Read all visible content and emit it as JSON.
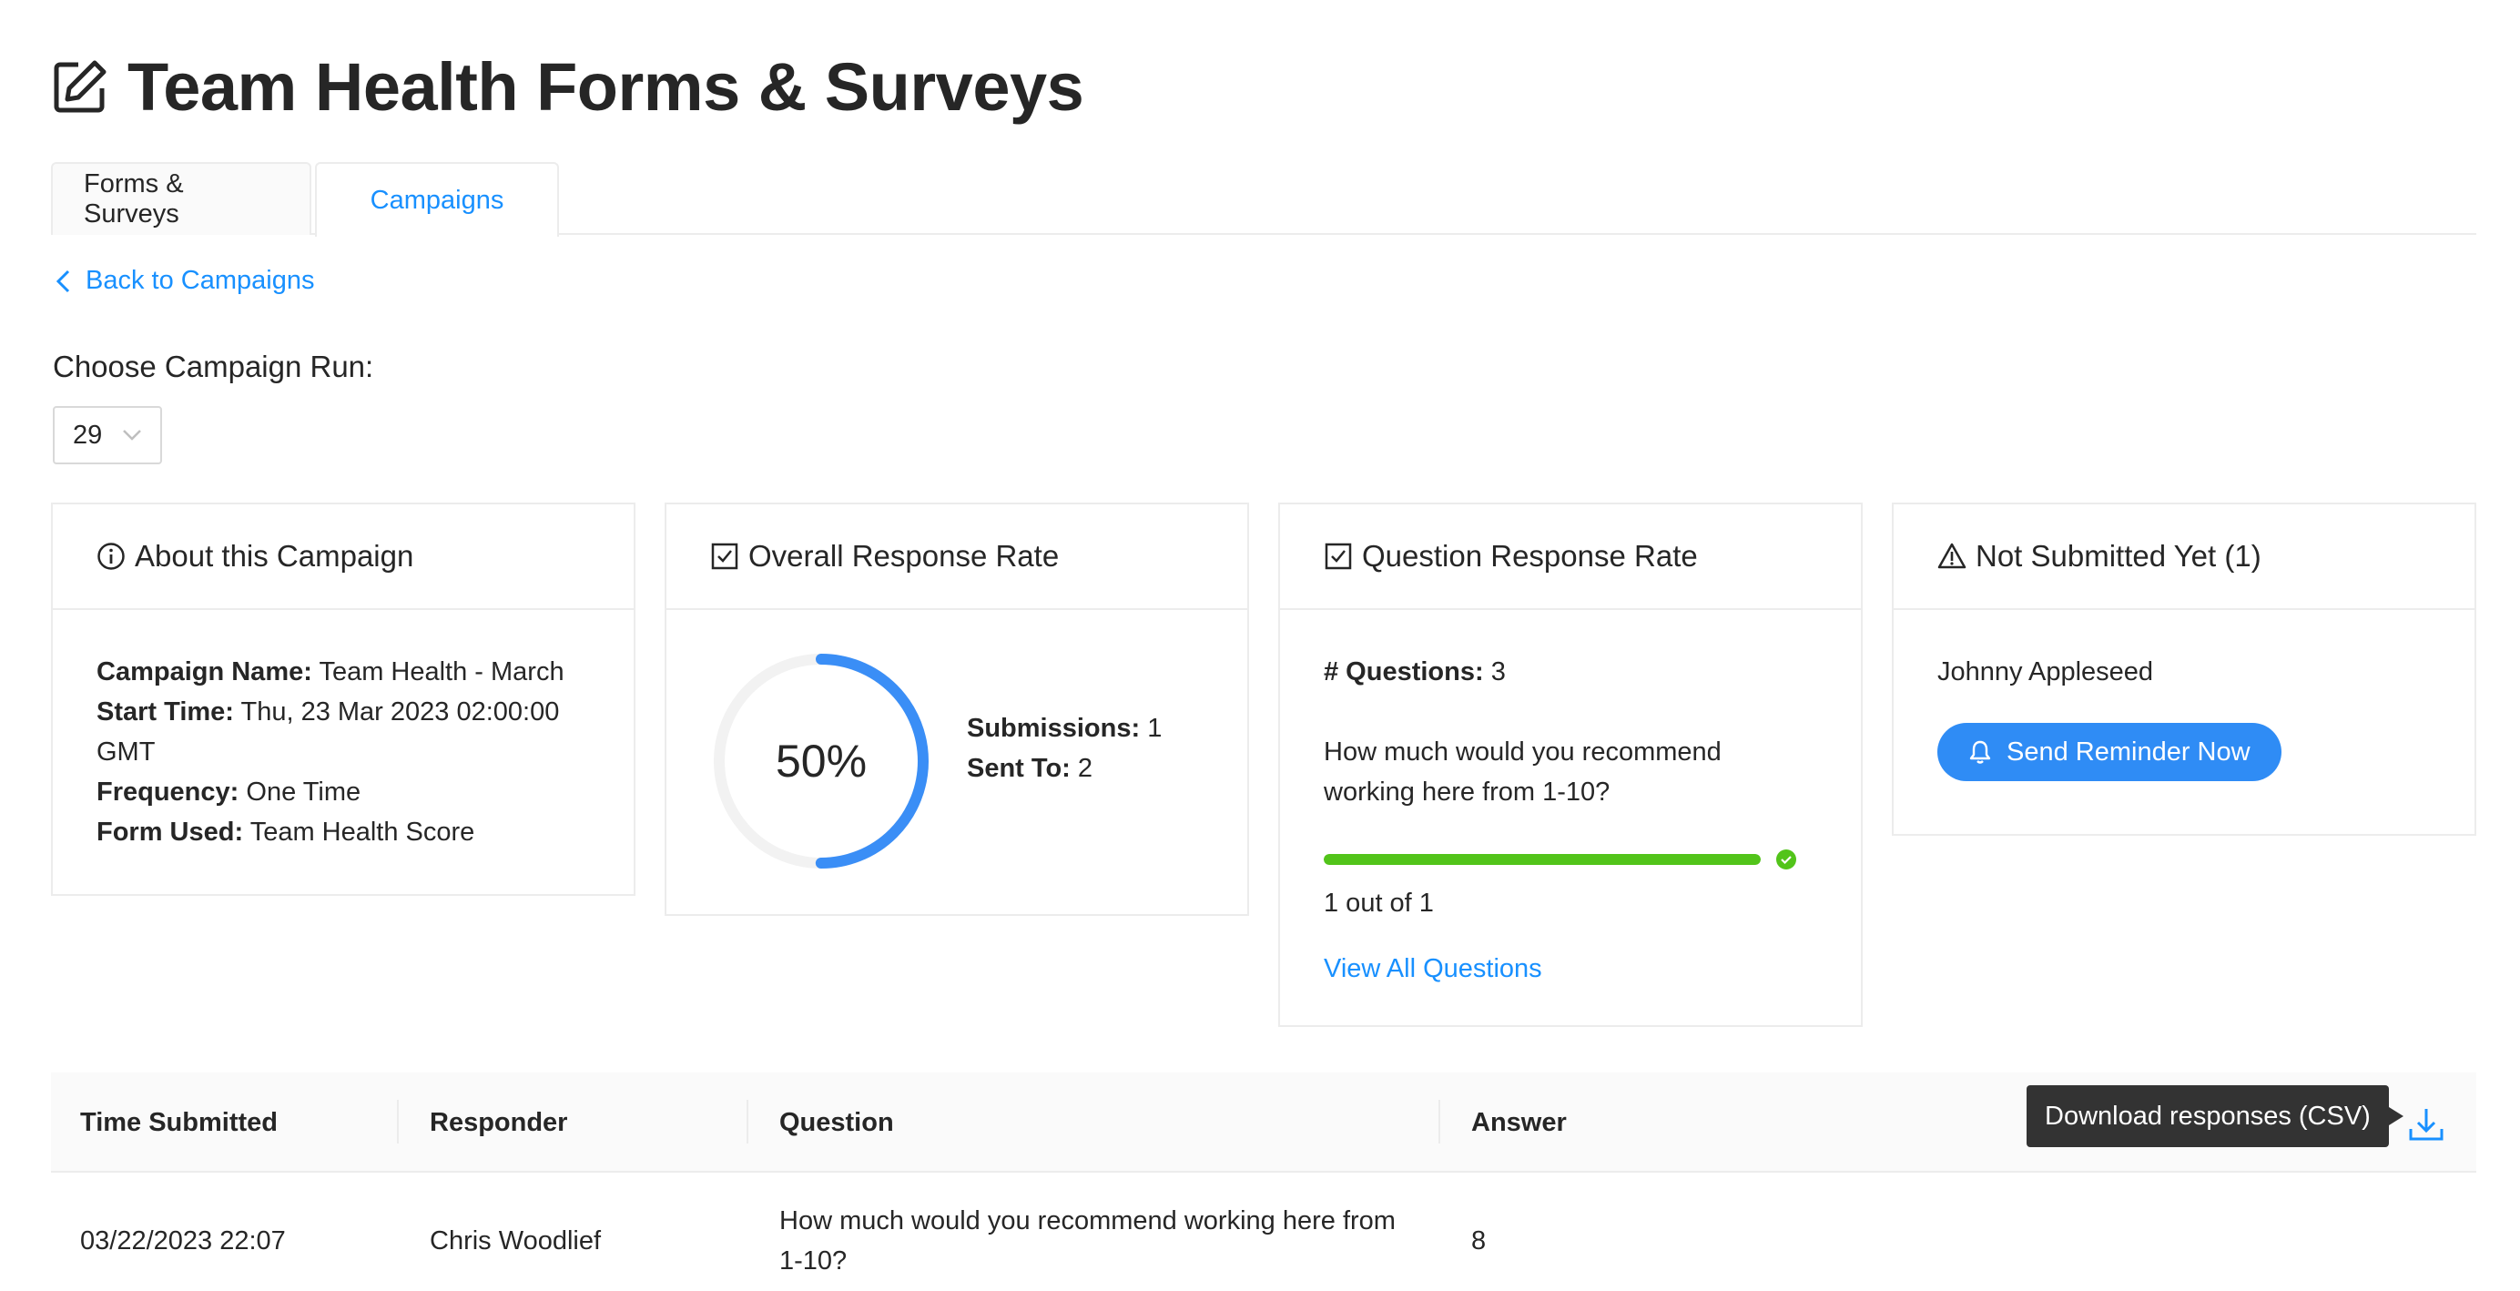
{
  "page": {
    "title": "Team Health Forms & Surveys",
    "title_icon": "edit-icon"
  },
  "tabs": [
    {
      "label": "Forms & Surveys",
      "active": false
    },
    {
      "label": "Campaigns",
      "active": true
    }
  ],
  "back_link": {
    "label": "Back to Campaigns",
    "icon": "chevron-left-icon"
  },
  "campaign_run": {
    "label": "Choose Campaign Run:",
    "selected": "29"
  },
  "about": {
    "title": "About this Campaign",
    "icon": "info-icon",
    "fields": {
      "name_label": "Campaign Name:",
      "name_value": "Team Health - March",
      "start_label": "Start Time:",
      "start_value": "Thu, 23 Mar 2023 02:00:00 GMT",
      "frequency_label": "Frequency:",
      "frequency_value": "One Time",
      "form_label": "Form Used:",
      "form_value": "Team Health Score"
    }
  },
  "overall": {
    "title": "Overall Response Rate",
    "icon": "checkbox-icon",
    "percent_label": "50%",
    "percent": 0.5,
    "submissions_label": "Submissions:",
    "submissions_value": "1",
    "sent_label": "Sent To:",
    "sent_value": "2",
    "accent": "#3a8ef6"
  },
  "question_rate": {
    "title": "Question Response Rate",
    "icon": "checkbox-icon",
    "count_label": "# Questions:",
    "count_value": "3",
    "question": "How much would you recommend working here from 1-10?",
    "progress": 1.0,
    "progress_color": "#52c41a",
    "out_of": "1 out of 1",
    "view_all": "View All Questions"
  },
  "not_submitted": {
    "title": "Not Submitted Yet (1)",
    "icon": "warning-icon",
    "person": "Johnny Appleseed",
    "button_label": "Send Reminder Now",
    "button_icon": "bell-icon",
    "button_color": "#2f8cf5"
  },
  "table": {
    "columns": [
      "Time Submitted",
      "Responder",
      "Question",
      "Answer"
    ],
    "tooltip": "Download responses (CSV)",
    "download_icon": "download-icon",
    "rows": [
      {
        "time": "03/22/2023 22:07",
        "responder": "Chris Woodlief",
        "question": "How much would you recommend working here from 1-10?",
        "answer": "8"
      }
    ]
  }
}
